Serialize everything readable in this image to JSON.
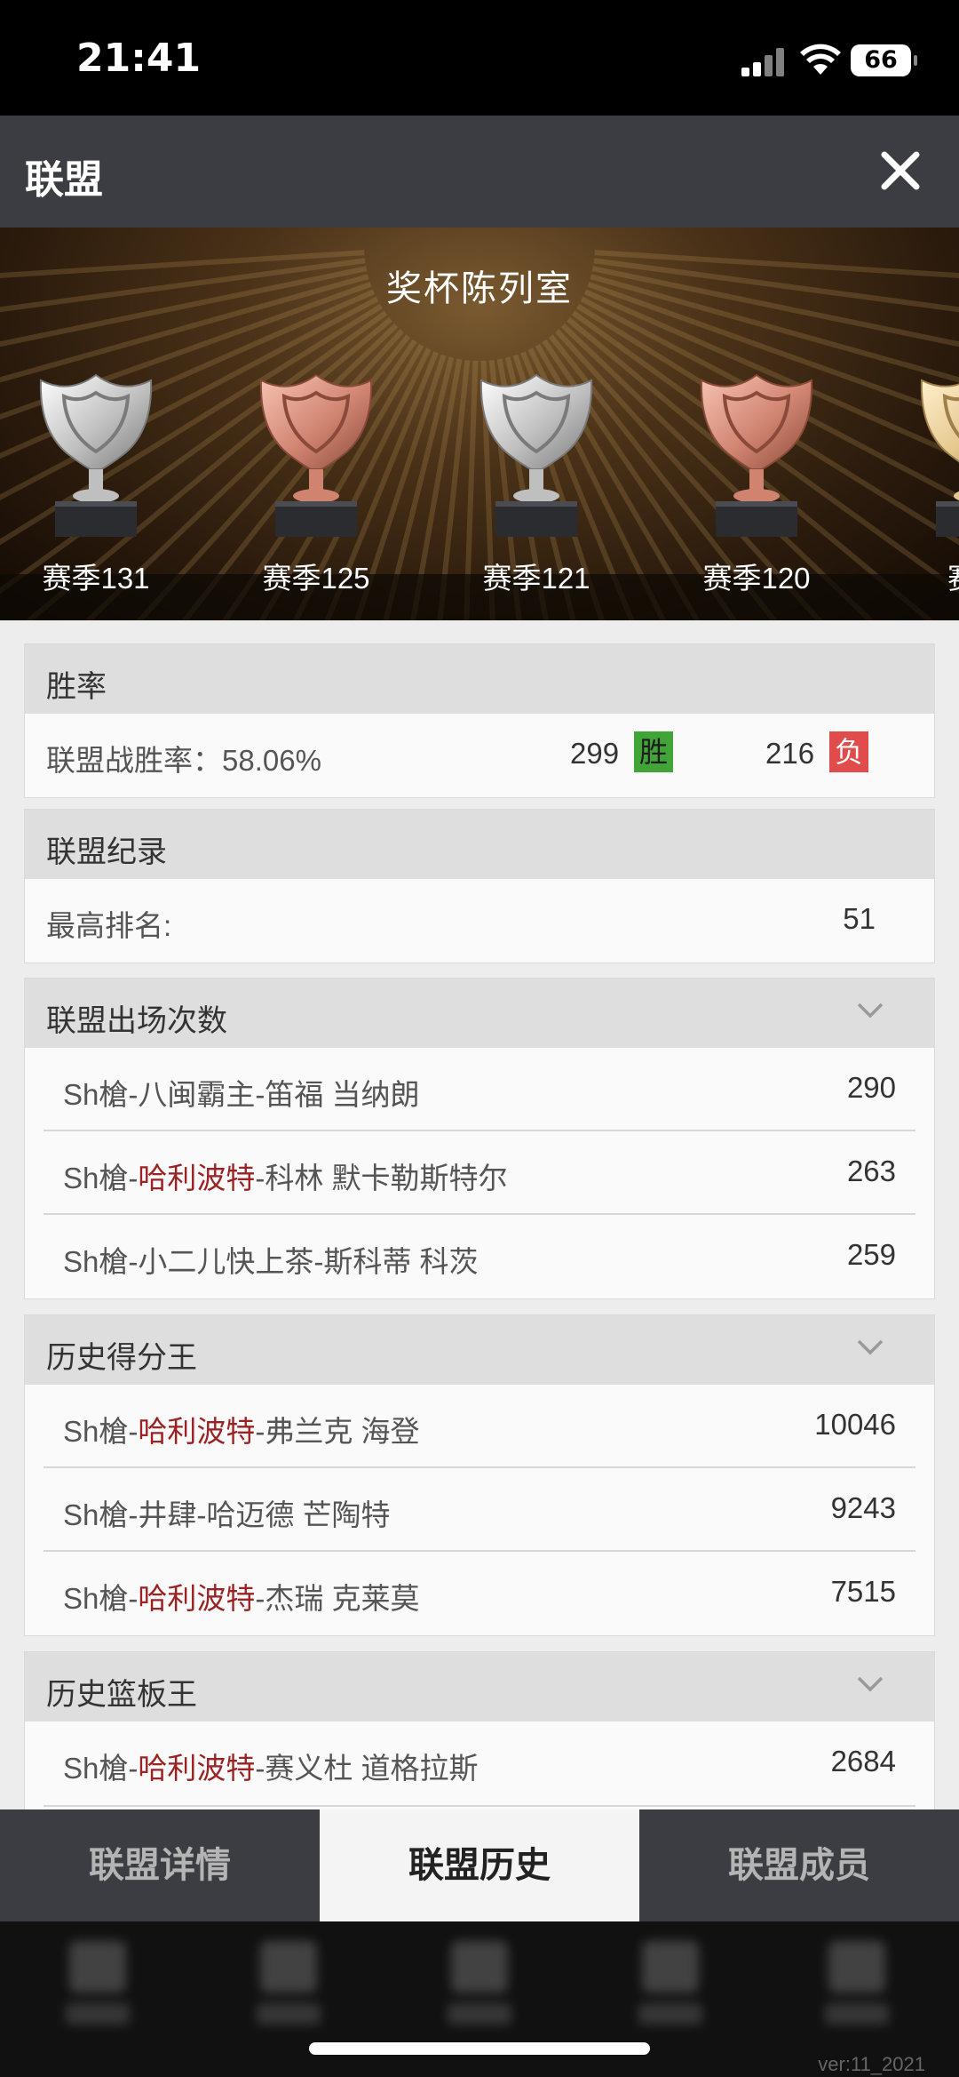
{
  "status": {
    "time": "21:41",
    "battery": "66"
  },
  "header": {
    "title": "联盟"
  },
  "trophy_hall": {
    "title": "奖杯陈列室",
    "trophies": [
      {
        "label": "赛季131",
        "medal": "silver"
      },
      {
        "label": "赛季125",
        "medal": "bronze"
      },
      {
        "label": "赛季121",
        "medal": "silver"
      },
      {
        "label": "赛季120",
        "medal": "bronze"
      },
      {
        "label": "赛季",
        "medal": "gold"
      }
    ]
  },
  "win_rate": {
    "title": "胜率",
    "label": "联盟战胜率：58.06%",
    "wins": "299",
    "win_badge": "胜",
    "losses": "216",
    "loss_badge": "负"
  },
  "records": {
    "title": "联盟纪录",
    "best_rank_label": "最高排名:",
    "best_rank_value": "51"
  },
  "appearances": {
    "title": "联盟出场次数",
    "rows": [
      {
        "prefix": "Sh槍-",
        "highlight": "",
        "suffix": "八闽霸主-笛福 当纳朗",
        "value": "290"
      },
      {
        "prefix": "Sh槍-",
        "highlight": "哈利波特",
        "suffix": "-科林 默卡勒斯特尔",
        "value": "263"
      },
      {
        "prefix": "Sh槍-",
        "highlight": "",
        "suffix": "小二儿快上茶-斯科蒂 科茨",
        "value": "259"
      }
    ]
  },
  "scoring": {
    "title": "历史得分王",
    "rows": [
      {
        "prefix": "Sh槍-",
        "highlight": "哈利波特",
        "suffix": "-弗兰克 海登",
        "value": "10046"
      },
      {
        "prefix": "Sh槍-",
        "highlight": "",
        "suffix": "井肆-哈迈德 芒陶特",
        "value": "9243"
      },
      {
        "prefix": "Sh槍-",
        "highlight": "哈利波特",
        "suffix": "-杰瑞 克莱莫",
        "value": "7515"
      }
    ]
  },
  "rebounds": {
    "title": "历史篮板王",
    "rows": [
      {
        "prefix": "Sh槍-",
        "highlight": "哈利波特",
        "suffix": "-赛义杜 道格拉斯",
        "value": "2684"
      }
    ]
  },
  "tabs": {
    "details": "联盟详情",
    "history": "联盟历史",
    "members": "联盟成员",
    "active": "history"
  },
  "version": "ver:11_2021",
  "colors": {
    "win": "#41a437",
    "loss": "#e04b4b",
    "highlight": "#9b2222",
    "header": "#3b3d42"
  }
}
